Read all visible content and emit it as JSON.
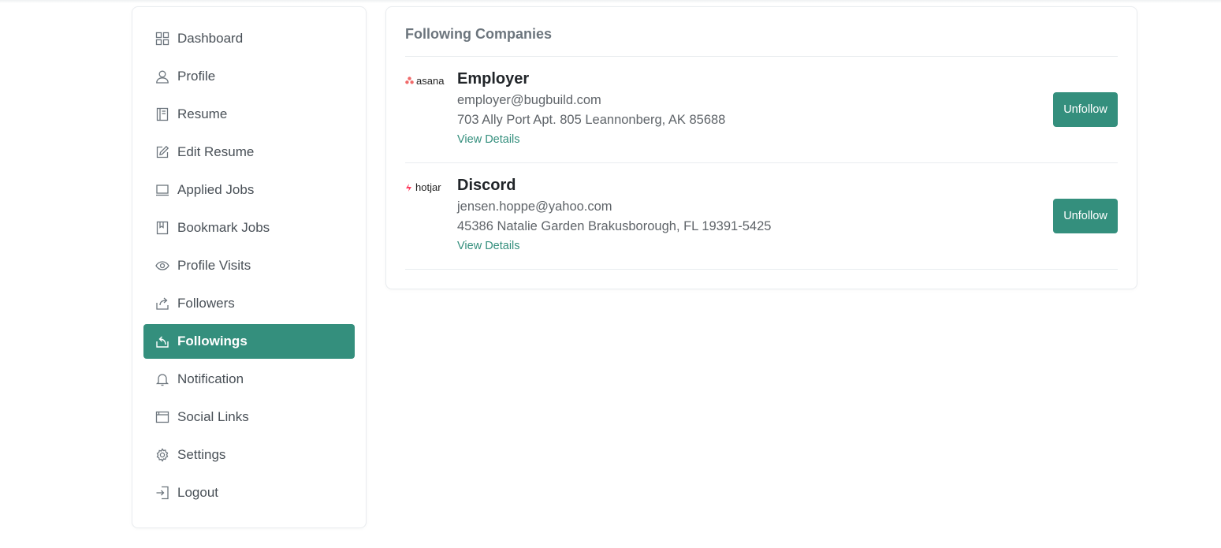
{
  "sidebar": {
    "items": [
      {
        "label": "Dashboard",
        "icon": "dashboard-icon",
        "active": false
      },
      {
        "label": "Profile",
        "icon": "user-icon",
        "active": false
      },
      {
        "label": "Resume",
        "icon": "resume-icon",
        "active": false
      },
      {
        "label": "Edit Resume",
        "icon": "edit-icon",
        "active": false
      },
      {
        "label": "Applied Jobs",
        "icon": "laptop-icon",
        "active": false
      },
      {
        "label": "Bookmark Jobs",
        "icon": "bookmark-icon",
        "active": false
      },
      {
        "label": "Profile Visits",
        "icon": "eye-icon",
        "active": false
      },
      {
        "label": "Followers",
        "icon": "share-icon",
        "active": false
      },
      {
        "label": "Followings",
        "icon": "followings-icon",
        "active": true
      },
      {
        "label": "Notification",
        "icon": "bell-icon",
        "active": false
      },
      {
        "label": "Social Links",
        "icon": "browser-icon",
        "active": false
      },
      {
        "label": "Settings",
        "icon": "gear-icon",
        "active": false
      },
      {
        "label": "Logout",
        "icon": "logout-icon",
        "active": false
      }
    ]
  },
  "main": {
    "title": "Following Companies",
    "companies": [
      {
        "logo_text": "asana",
        "logo_icon": "asana-logo-icon",
        "name": "Employer",
        "email": "employer@bugbuild.com",
        "address": "703 Ally Port Apt. 805 Leannonberg, AK 85688",
        "view_details": "View Details",
        "unfollow": "Unfollow"
      },
      {
        "logo_text": "hotjar",
        "logo_icon": "hotjar-logo-icon",
        "name": "Discord",
        "email": "jensen.hoppe@yahoo.com",
        "address": "45386 Natalie Garden Brakusborough, FL 19391-5425",
        "view_details": "View Details",
        "unfollow": "Unfollow"
      }
    ]
  },
  "colors": {
    "accent": "#348f7d",
    "text_muted": "#6c757d",
    "border": "#e9ecef",
    "asana": "#f06a6a",
    "hotjar": "#fd3a5c"
  }
}
